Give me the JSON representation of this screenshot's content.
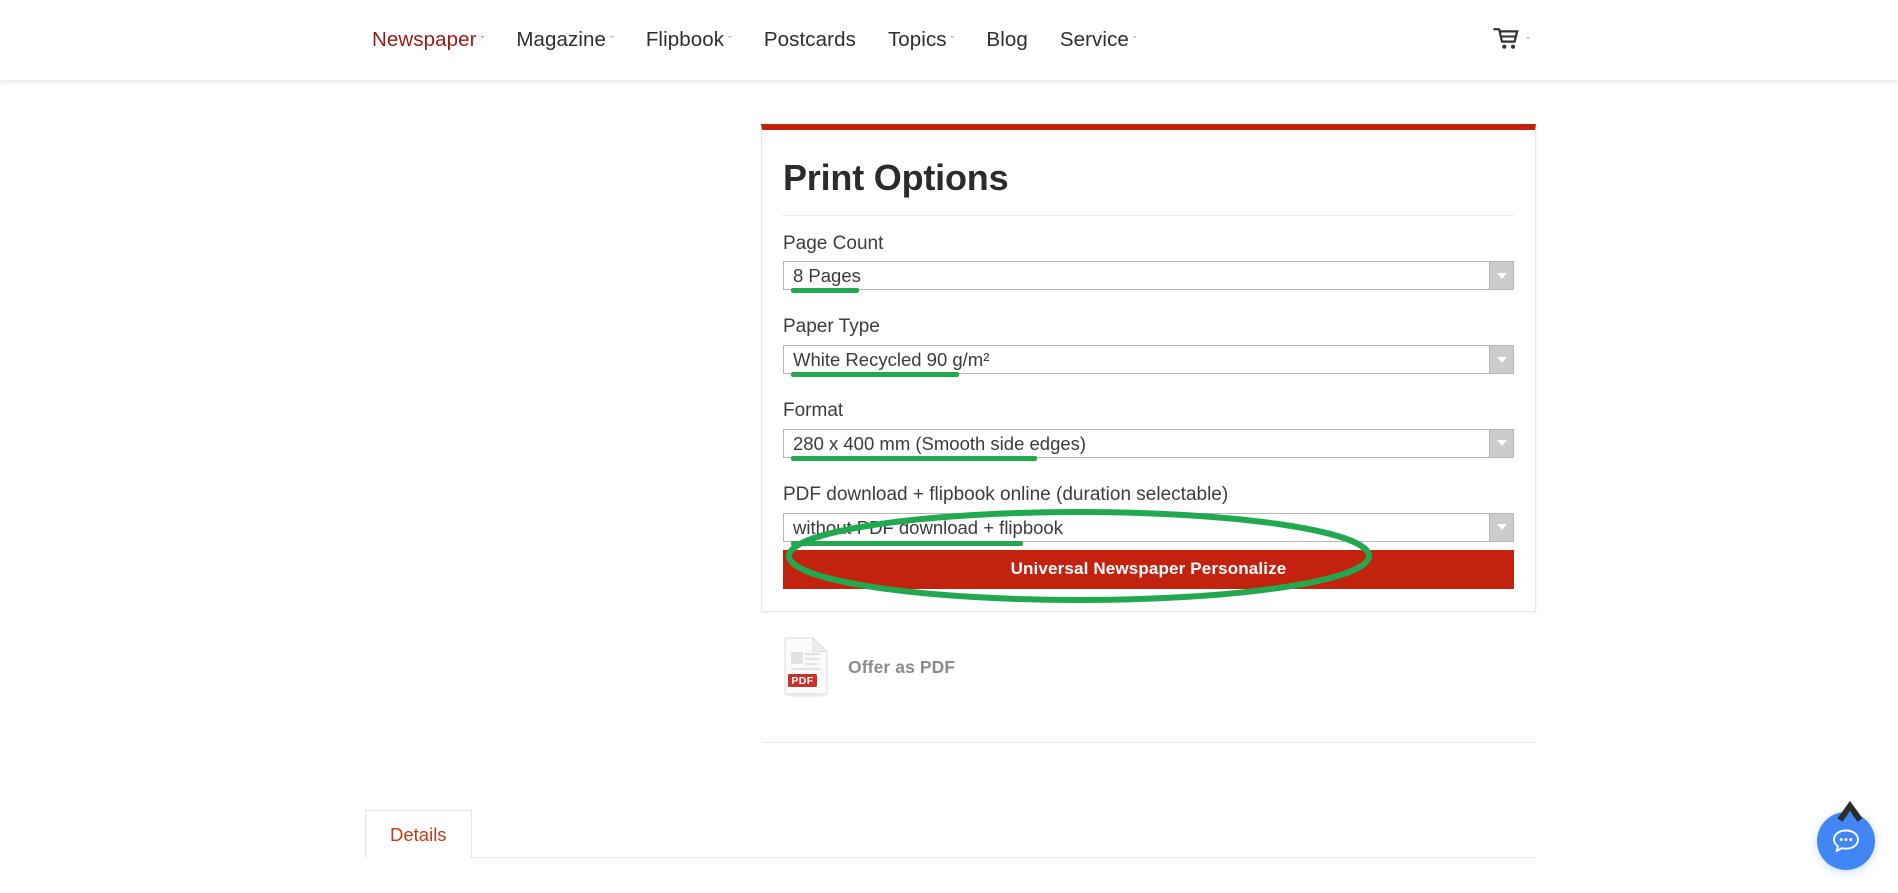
{
  "header": {
    "nav": [
      {
        "label": "Newspaper",
        "has_chevron": true,
        "active": true
      },
      {
        "label": "Magazine",
        "has_chevron": true,
        "active": false
      },
      {
        "label": "Flipbook",
        "has_chevron": true,
        "active": false
      },
      {
        "label": "Postcards",
        "has_chevron": false,
        "active": false
      },
      {
        "label": "Topics",
        "has_chevron": true,
        "active": false
      },
      {
        "label": "Blog",
        "has_chevron": false,
        "active": false
      },
      {
        "label": "Service",
        "has_chevron": true,
        "active": false
      }
    ],
    "chevron_glyph": "ˇ",
    "cart": {
      "icon": "shopping-cart-icon",
      "chevron": "ˇ"
    }
  },
  "print_options": {
    "title": "Print Options",
    "fields": [
      {
        "label": "Page Count",
        "value": "8 Pages",
        "annotated": true
      },
      {
        "label": "Paper Type",
        "value": "White Recycled 90 g/m²",
        "annotated": true
      },
      {
        "label": "Format",
        "value": "280 x 400 mm (Smooth side edges)",
        "annotated": true
      },
      {
        "label": "PDF download + flipbook online (duration selectable)",
        "value": "without PDF download + flipbook",
        "annotated": true
      }
    ],
    "primary_button": "Universal Newspaper Personalize"
  },
  "offer": {
    "label": "Offer as PDF",
    "icon": "pdf-file-icon",
    "badge_text": "PDF"
  },
  "tabs": [
    {
      "label": "Details",
      "active": true
    }
  ],
  "widgets": {
    "scroll_top": "scroll-to-top-icon",
    "chat": "chat-bubble-icon"
  },
  "colors": {
    "brand_red": "#c3220f",
    "nav_active": "#9b1b13",
    "annotation_green": "#22a84f",
    "chat_blue": "#4285f4",
    "tab_text": "#c33b1d"
  }
}
